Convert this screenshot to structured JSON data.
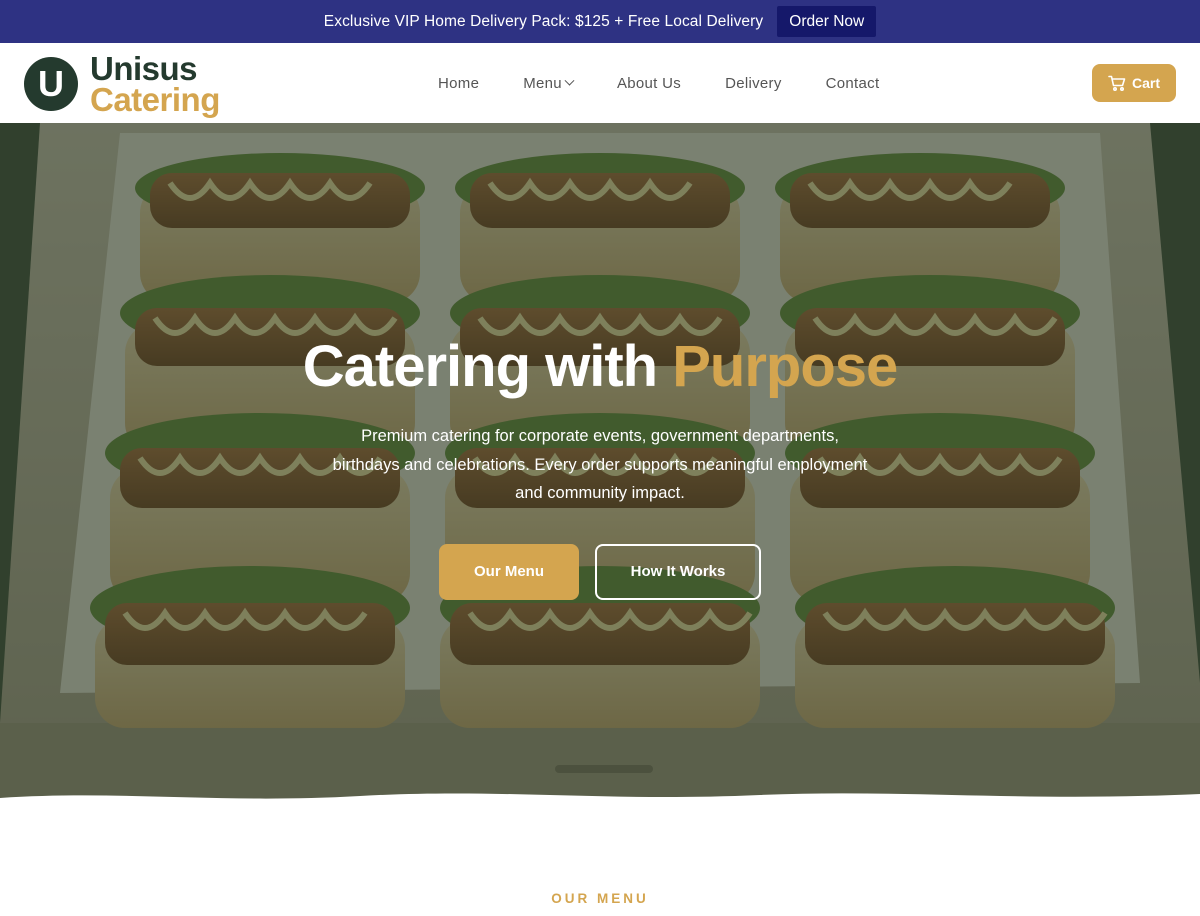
{
  "promo": {
    "text": "Exclusive VIP Home Delivery Pack: $125 + Free Local Delivery",
    "button_label": "Order Now"
  },
  "logo": {
    "mark": "U",
    "line1": "Unisus",
    "line2": "Catering"
  },
  "nav": {
    "items": [
      {
        "label": "Home"
      },
      {
        "label": "Menu"
      },
      {
        "label": "About Us"
      },
      {
        "label": "Delivery"
      },
      {
        "label": "Contact"
      }
    ],
    "cart_label": "Cart"
  },
  "hero": {
    "title_main": "Catering with ",
    "title_accent": "Purpose",
    "subtitle": "Premium catering for corporate events, government departments, birthdays and celebrations. Every order supports meaningful employment and community impact.",
    "primary_button": "Our Menu",
    "secondary_button": "How It Works"
  },
  "section": {
    "label": "OUR MENU"
  },
  "colors": {
    "promo_bg": "#2e3283",
    "promo_button_bg": "#15186a",
    "brand_dark": "#243a2e",
    "brand_gold": "#d4a54f"
  },
  "icons": {
    "cart": "shopping-cart-icon",
    "menu_dropdown": "chevron-down-icon"
  }
}
